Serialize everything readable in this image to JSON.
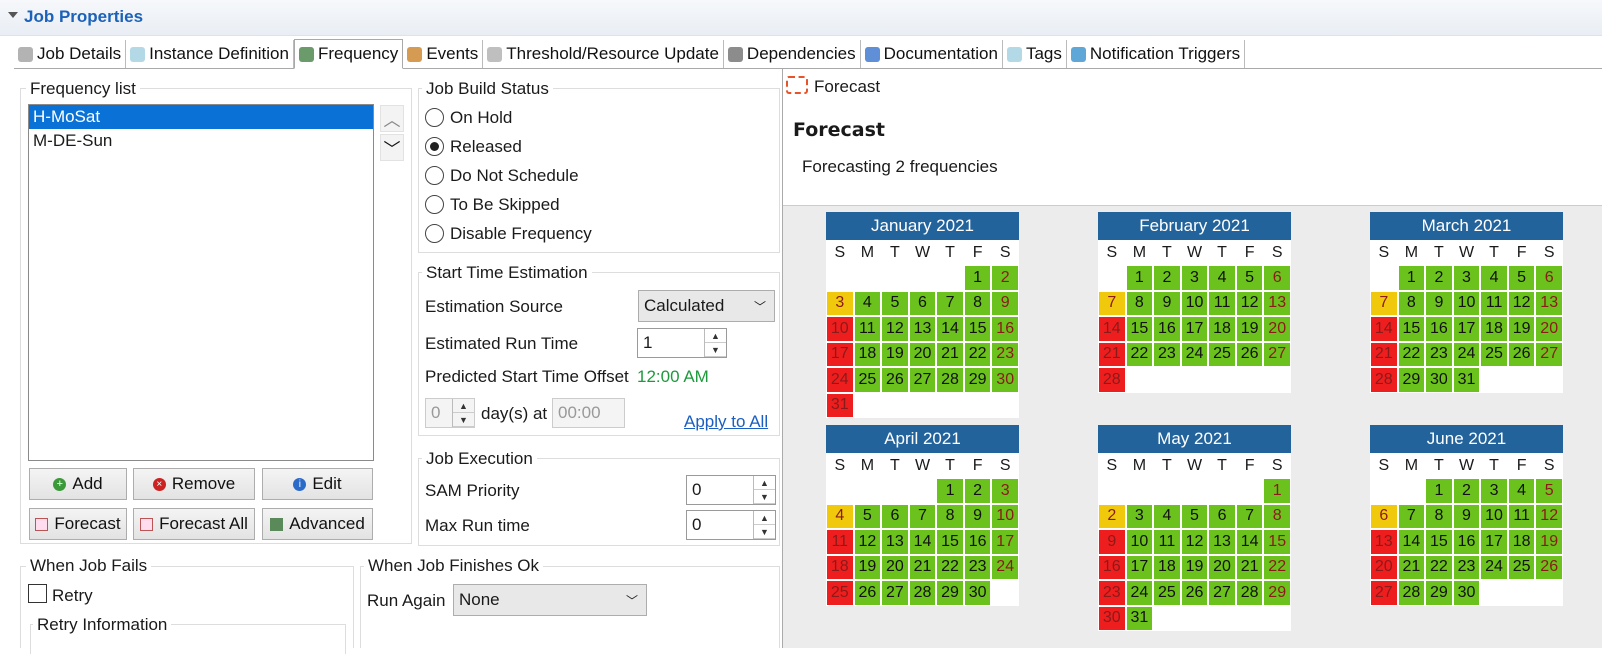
{
  "window": {
    "title": "Job Properties"
  },
  "tabs": [
    {
      "label": "Job Details",
      "icon": "gear-icon"
    },
    {
      "label": "Instance Definition",
      "icon": "tag-icon"
    },
    {
      "label": "Frequency",
      "icon": "chart-icon",
      "active": true
    },
    {
      "label": "Events",
      "icon": "event-icon"
    },
    {
      "label": "Threshold/Resource Update",
      "icon": "bars-icon"
    },
    {
      "label": "Dependencies",
      "icon": "link-icon"
    },
    {
      "label": "Documentation",
      "icon": "info-icon"
    },
    {
      "label": "Tags",
      "icon": "tag-icon"
    },
    {
      "label": "Notification Triggers",
      "icon": "signal-icon"
    }
  ],
  "frequency_list": {
    "label": "Frequency list",
    "items": [
      "H-MoSat",
      "M-DE-Sun"
    ],
    "selected": "H-MoSat"
  },
  "buttons": {
    "add": "Add",
    "remove": "Remove",
    "edit": "Edit",
    "forecast": "Forecast",
    "forecast_all": "Forecast All",
    "advanced": "Advanced"
  },
  "build_status": {
    "label": "Job Build Status",
    "options": [
      "On Hold",
      "Released",
      "Do Not Schedule",
      "To Be Skipped",
      "Disable Frequency"
    ],
    "selected": "Released"
  },
  "start_time": {
    "label": "Start Time Estimation",
    "source_label": "Estimation Source",
    "source_value": "Calculated",
    "run_time_label": "Estimated Run Time",
    "run_time_value": "1",
    "offset_label": "Predicted Start Time Offset",
    "offset_value": "12:00 AM",
    "days_value": "0",
    "days_label": "day(s) at",
    "time_value": "00:00",
    "apply_all": "Apply to All"
  },
  "execution": {
    "label": "Job Execution",
    "sam_label": "SAM Priority",
    "sam_value": "0",
    "max_label": "Max Run time",
    "max_value": "0"
  },
  "fails": {
    "label": "When Job Fails",
    "retry": "Retry",
    "retry_info": "Retry Information"
  },
  "finishes": {
    "label": "When Job Finishes Ok",
    "run_again_label": "Run Again",
    "run_again_value": "None"
  },
  "forecast": {
    "tab": "Forecast",
    "heading": "Forecast",
    "subtitle": "Forecasting 2 frequencies"
  },
  "weekday_letters": [
    "S",
    "M",
    "T",
    "W",
    "T",
    "F",
    "S"
  ],
  "months": [
    {
      "name": "January 2021",
      "offset": 5,
      "days": 31,
      "weeks": 6,
      "colors": "gggggggygggggggrgggggggrgggggggrgggggg",
      "c": "e,e,e,e,e,g,gr|y,g,g,g,g,g,gr|r,g,g,g,g,g,gr|r,g,g,g,g,g,gr|r,g,g,g,g,g,gr|r"
    },
    {
      "name": "February 2021",
      "offset": 1,
      "days": 28,
      "weeks": 5,
      "c": "e,g,g,g,g,g,gr|y,g,g,g,g,g,gr|r,g,g,g,g,g,gr|r,g,g,g,g,g,gr|r"
    },
    {
      "name": "March 2021",
      "offset": 1,
      "days": 31,
      "weeks": 5,
      "c": "e,g,g,g,g,g,gr|y,g,g,g,g,g,gr|r,g,g,g,g,g,gr|r,g,g,g,g,g,gr|r,g,g,g"
    },
    {
      "name": "April 2021",
      "offset": 4,
      "days": 30,
      "weeks": 5,
      "c": "e,e,e,e,g,g,gr|y,g,g,g,g,g,gr|r,g,g,g,g,g,gr|r,g,g,g,g,g,gr|r,g,g,g,g,g"
    },
    {
      "name": "May 2021",
      "offset": 6,
      "days": 31,
      "weeks": 6,
      "c": "e,e,e,e,e,e,gr|y,g,g,g,g,g,gr|r,g,g,g,g,g,gr|r,g,g,g,g,g,gr|r,g,g,g,g,g,gr|r,g"
    },
    {
      "name": "June 2021",
      "offset": 2,
      "days": 30,
      "weeks": 5,
      "c": "e,e,g,g,g,g,gr|y,g,g,g,g,g,gr|r,g,g,g,g,g,gr|r,g,g,g,g,g,gr|r,g,g,g"
    }
  ],
  "colors": {
    "accent": "#1c62b9",
    "cal_header": "#23639c",
    "green": "#6cc21d",
    "red": "#ef1e1e",
    "yellow": "#f0c80c",
    "selection": "#0a72d7"
  }
}
